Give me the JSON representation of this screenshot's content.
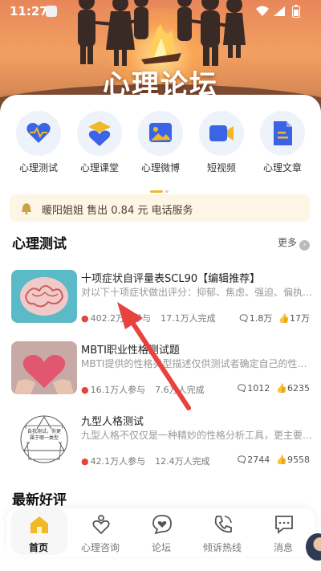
{
  "status_bar": {
    "time": "11:27"
  },
  "hero": {
    "title": "心理论坛"
  },
  "categories": [
    {
      "label": "心理测试",
      "icon": "heart-pulse-icon"
    },
    {
      "label": "心理课堂",
      "icon": "graduation-heart-icon"
    },
    {
      "label": "心理微博",
      "icon": "image-icon"
    },
    {
      "label": "短视频",
      "icon": "video-camera-icon"
    },
    {
      "label": "心理文章",
      "icon": "document-icon"
    }
  ],
  "notice": {
    "text": "暖阳姐姐 售出 0.84 元 电话服务"
  },
  "tests_section": {
    "title": "心理测试",
    "more": "更多"
  },
  "tests": [
    {
      "title": "十项症状自评量表SCL90【编辑推荐】",
      "desc": "对以下十项症状做出评分：抑郁、焦虑、强迫、偏执、...",
      "participants": "402.2万人参与",
      "completed": "17.1万人完成",
      "comments": "1.8万",
      "likes": "17万"
    },
    {
      "title": "MBTI职业性格测试题",
      "desc": "MBTI提供的性格类型描述仅供测试者确定自己的性格类...",
      "participants": "16.1万人参与",
      "completed": "7.6万人完成",
      "comments": "1012",
      "likes": "6235"
    },
    {
      "title": "九型人格测试",
      "desc": "九型人格不仅仅是一种精妙的性格分析工具，更主要的...",
      "participants": "42.1万人参与",
      "completed": "12.4万人完成",
      "comments": "2744",
      "likes": "9558",
      "thumb_text": "自我测试，你更属于哪一类型"
    }
  ],
  "reviews_section": {
    "title": "最新好评"
  },
  "nav": [
    {
      "label": "首页",
      "active": true
    },
    {
      "label": "心理咨询",
      "active": false
    },
    {
      "label": "论坛",
      "active": false
    },
    {
      "label": "倾诉热线",
      "active": false
    },
    {
      "label": "消息",
      "active": false
    }
  ],
  "colors": {
    "accent": "#f1b828",
    "icon_blue": "#3b63e6",
    "icon_bg": "#eef2fb",
    "fire": "#e2453c",
    "arrow": "#e8423f"
  }
}
